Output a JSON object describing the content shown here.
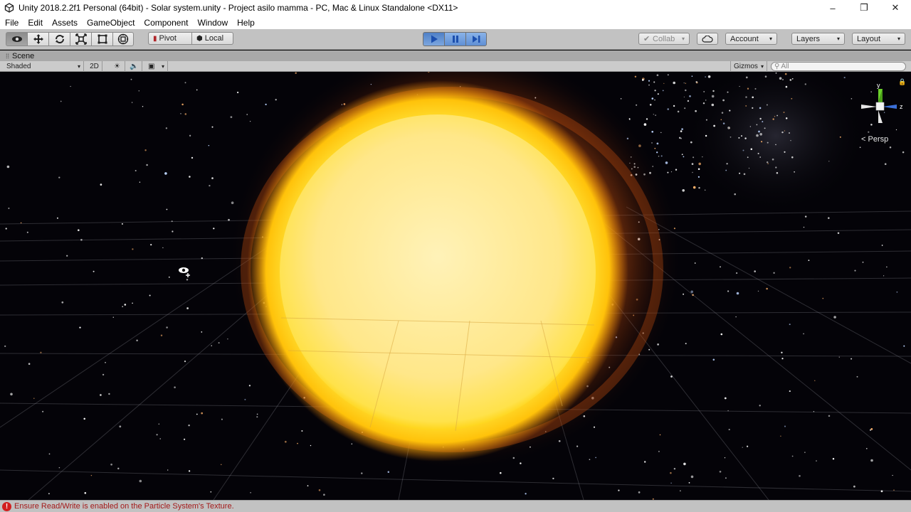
{
  "window": {
    "title": "Unity 2018.2.2f1 Personal (64bit) - Solar system.unity - Project asilo mamma - PC, Mac & Linux Standalone <DX11>",
    "minimize_glyph": "–",
    "restore_glyph": "❐",
    "close_glyph": "✕"
  },
  "menu": {
    "items": [
      "File",
      "Edit",
      "Assets",
      "GameObject",
      "Component",
      "Window",
      "Help"
    ]
  },
  "toolbar": {
    "transform_tools": [
      {
        "name": "view-tool-icon",
        "active": true
      },
      {
        "name": "move-tool-icon",
        "active": false
      },
      {
        "name": "rotate-tool-icon",
        "active": false
      },
      {
        "name": "scale-tool-icon",
        "active": false
      },
      {
        "name": "rect-tool-icon",
        "active": false
      },
      {
        "name": "transform-tool-icon",
        "active": false
      }
    ],
    "pivot_label": "Pivot",
    "local_label": "Local",
    "play_controls": [
      "play-icon",
      "pause-icon",
      "step-icon"
    ],
    "collab_label": "Collab",
    "account_label": "Account",
    "layers_label": "Layers",
    "layout_label": "Layout"
  },
  "scene": {
    "tab_label": "Scene",
    "shading_mode": "Shaded",
    "mode_2d": "2D",
    "gizmos_label": "Gizmos",
    "search_placeholder": "All",
    "projection": "Persp",
    "axis_labels": {
      "y": "y",
      "z": "z"
    }
  },
  "status": {
    "message": "Ensure Read/Write is enabled on the Particle System's Texture.",
    "icon": "error-icon",
    "color": "#a31919"
  },
  "colors": {
    "play_active": "#5f8fd4",
    "sun_core": "#fff2a6",
    "sun_glow": "#ffd21a",
    "corona": "#c8510e",
    "gizmo_y": "#6bd12b",
    "gizmo_z": "#3b6fd8"
  }
}
